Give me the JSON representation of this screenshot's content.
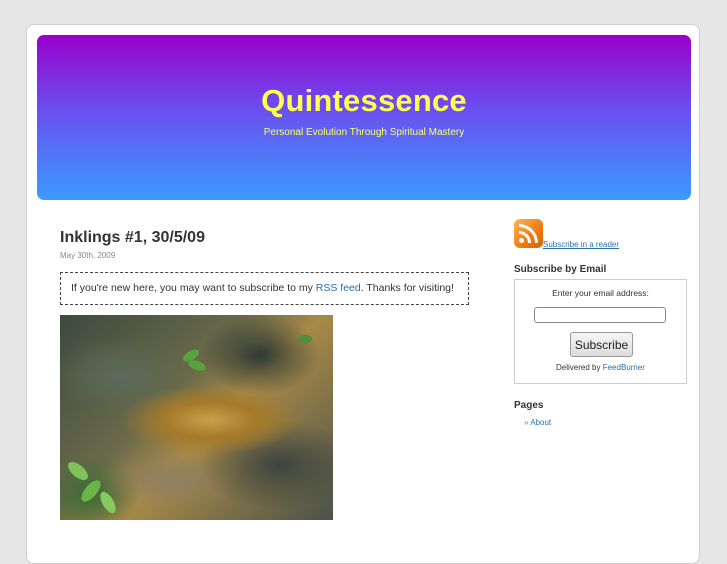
{
  "site": {
    "title": "Quintessence",
    "tagline": "Personal Evolution Through Spiritual Mastery"
  },
  "post": {
    "title": "Inklings #1, 30/5/09",
    "date": "May 30th, 2009",
    "notice_before": "If you're new here, you may want to subscribe to my ",
    "notice_link": "RSS feed",
    "notice_after": ". Thanks for visiting!"
  },
  "sidebar": {
    "rss_icon": "rss-feed-icon",
    "rss_link": "Subscribe in a reader",
    "email_title": "Subscribe by Email",
    "email_label": "Enter your email address:",
    "email_value": "",
    "subscribe_button": "Subscribe",
    "delivered_by": "Delivered by",
    "feedburner": "FeedBurner",
    "pages_title": "Pages",
    "pages": [
      {
        "bullet": "»",
        "label": "About"
      }
    ]
  },
  "colors": {
    "header_top": "#9a00cc",
    "header_bottom": "#3a9bff",
    "title": "#ffff4d",
    "link": "#2a6fb0"
  }
}
